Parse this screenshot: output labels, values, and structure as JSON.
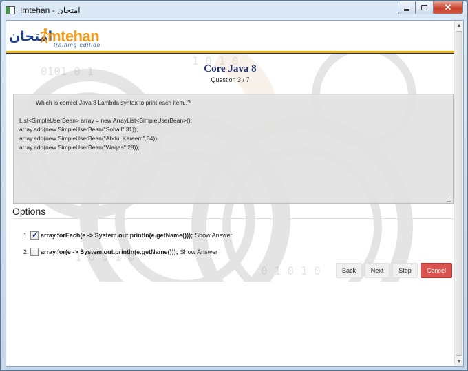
{
  "window": {
    "title": "Imtehan - امتحان",
    "controls": {
      "minimize": "minimize",
      "maximize": "maximize",
      "close": "✕"
    }
  },
  "logo": {
    "arabic": "امتحان",
    "english": "mtehan",
    "subtitle": "training edition"
  },
  "exam": {
    "title": "Core Java 8",
    "counter": "Question 3 / 7"
  },
  "question": {
    "text": "Which is correct Java 8 Lambda syntax to print each item..?",
    "code": [
      "List<SimpleUserBean> array = new ArrayList<SimpleUserBean>();",
      "array.add(new SimpleUserBean(\"Sohail\",31));",
      "array.add(new SimpleUserBean(\"Abdul Kareem\",34));",
      "array.add(new SimpleUserBean(\"Waqas\",28));"
    ]
  },
  "options": {
    "heading": "Options",
    "items": [
      {
        "num": "1.",
        "checked": true,
        "code": "array.forEach(e -> System.out.println(e.getName()));",
        "show": "Show Answer"
      },
      {
        "num": "2.",
        "checked": false,
        "code": "array.for(e -> System.out.println(e.getName()));",
        "show": "Show Answer"
      }
    ]
  },
  "buttons": {
    "back": "Back",
    "next": "Next",
    "stop": "Stop",
    "cancel": "Cancel"
  },
  "colors": {
    "cancel": "#d9534f",
    "title": "#1e2f6a",
    "gold_rule": "#f0b400",
    "logo_orange": "#f29b1d"
  },
  "icons": {
    "scroll_up": "▲",
    "scroll_down": "▼"
  }
}
